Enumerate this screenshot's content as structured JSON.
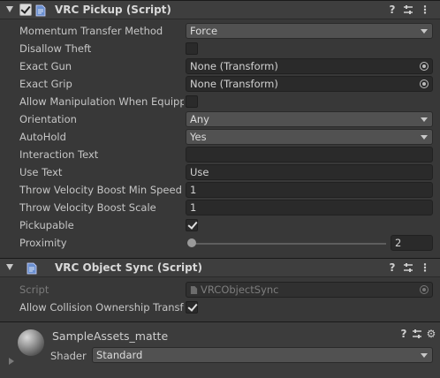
{
  "pickup": {
    "title": "VRC Pickup (Script)",
    "fields": {
      "momentum": {
        "label": "Momentum Transfer Method",
        "value": "Force"
      },
      "disallow_theft": {
        "label": "Disallow Theft",
        "checked": false
      },
      "exact_gun": {
        "label": "Exact Gun",
        "value": "None (Transform)"
      },
      "exact_grip": {
        "label": "Exact Grip",
        "value": "None (Transform)"
      },
      "allow_manip": {
        "label": "Allow Manipulation When Equipped",
        "checked": false
      },
      "orientation": {
        "label": "Orientation",
        "value": "Any"
      },
      "autohold": {
        "label": "AutoHold",
        "value": "Yes"
      },
      "interaction_text": {
        "label": "Interaction Text",
        "value": ""
      },
      "use_text": {
        "label": "Use Text",
        "value": "Use"
      },
      "throw_min": {
        "label": "Throw Velocity Boost Min Speed",
        "value": "1"
      },
      "throw_scale": {
        "label": "Throw Velocity Boost Scale",
        "value": "1"
      },
      "pickupable": {
        "label": "Pickupable",
        "checked": true
      },
      "proximity": {
        "label": "Proximity",
        "value": "2",
        "slider_fraction": 0.0
      }
    }
  },
  "object_sync": {
    "title": "VRC Object Sync (Script)",
    "script": {
      "label": "Script",
      "value": "VRCObjectSync"
    },
    "allow_collision": {
      "label": "Allow Collision Ownership Transfer",
      "checked": true
    }
  },
  "material": {
    "name": "SampleAssets_matte",
    "shader_label": "Shader",
    "shader_value": "Standard"
  },
  "icons": {
    "help": "?",
    "presets": "sliders-icon",
    "menu": "⋮",
    "settings": "⚙"
  }
}
